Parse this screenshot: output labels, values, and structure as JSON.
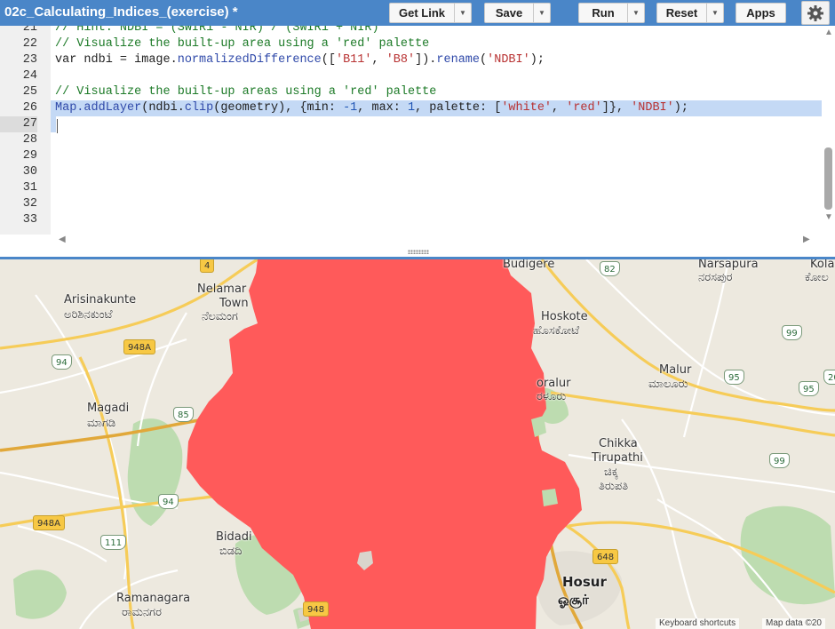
{
  "toolbar": {
    "script_title": "02c_Calculating_Indices_(exercise) *",
    "get_link": "Get Link",
    "save": "Save",
    "run": "Run",
    "reset": "Reset",
    "apps": "Apps"
  },
  "editor": {
    "line_numbers": [
      "21",
      "22",
      "23",
      "24",
      "25",
      "26",
      "27",
      "28",
      "29",
      "30",
      "31",
      "32",
      "33"
    ],
    "active_line": "27",
    "lines": {
      "l21": "// Hint: NDBI = (SWIR1 - NIR) / (SWIR1 + NIR)",
      "l22": "// Visualize the built-up area using a 'red' palette",
      "l23": {
        "a": "var ndbi = image.",
        "b": "normalizedDifference",
        "c": "([",
        "d": "'B11'",
        "e": ", ",
        "f": "'B8'",
        "g": "]).",
        "h": "rename",
        "i": "(",
        "j": "'NDBI'",
        "k": ");"
      },
      "l25": "// Visualize the built-up areas using a 'red' palette",
      "l26": {
        "a": "Map.addLayer",
        "b": "(ndbi.",
        "c": "clip",
        "d": "(geometry), {min: ",
        "e": "-1",
        "f": ", max: ",
        "g": "1",
        "h": ", palette: [",
        "i": "'white'",
        "j": ", ",
        "k": "'red'",
        "l": "]}, ",
        "m": "'NDBI'",
        "n": ");"
      }
    }
  },
  "map": {
    "overlay_color": "#ff5a5a",
    "places": {
      "arisinakunte": "Arisinakunte",
      "arisinakunte_kn": "ಅರಿಶಿನಕುಂಟೆ",
      "nelamangala": "Nelamar",
      "nelamangala_town": "Town",
      "nelamangala_kn": "ನೆಲಮಂಗ",
      "magadi": "Magadi",
      "magadi_kn": "ಮಾಗಡಿ",
      "bidadi": "Bidadi",
      "bidadi_kn": "ಬಿಡದಿ",
      "ramanagara": "Ramanagara",
      "ramanagara_kn": "ರಾಮನಗರ",
      "budigere": "Budigere",
      "narsapura": "Narsapura",
      "narsapura_kn": "ನರಸಪುರ",
      "kolar": "Kola",
      "kolar_kn": "ಕೋಲ",
      "hoskote": "Hoskote",
      "hoskote_kn": "ಹೊಸಕೋಟೆ",
      "sarjapura": "oralur",
      "sarjapura_kn": "ರಳೂರು",
      "malur": "Malur",
      "malur_kn": "ಮಾಲೂರು",
      "chikka": "Chikka",
      "tirupathi": "Tirupathi",
      "chikka_kn": "ಚಿಕ್ಕ",
      "tirupathi_kn": "ತಿರುಪತಿ",
      "hosur": "Hosur",
      "hosur_kn": "ஓசூர்"
    },
    "shields": {
      "s4": "4",
      "s82": "82",
      "s948a_top": "948A",
      "s94_top": "94",
      "s85": "85",
      "s94_mid": "94",
      "s948a_left": "948A",
      "s111": "111",
      "s948": "948",
      "s648": "648",
      "s99_top": "99",
      "s95_a": "95",
      "s95_b": "95",
      "s99_bottom": "99",
      "s20": "20"
    },
    "attribution": {
      "shortcuts": "Keyboard shortcuts",
      "map_data": "Map data ©20"
    }
  }
}
